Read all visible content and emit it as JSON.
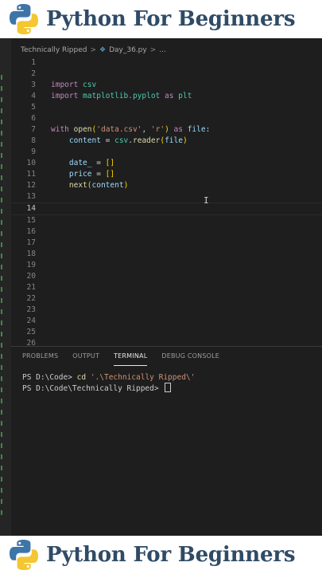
{
  "banner": {
    "title": "Python For Beginners"
  },
  "breadcrumb": {
    "folder": "Technically Ripped",
    "separator": ">",
    "file": "Day_36.py",
    "more": "..."
  },
  "editor": {
    "current_line": 14,
    "lines": [
      {
        "n": "1",
        "tokens": []
      },
      {
        "n": "2",
        "tokens": []
      },
      {
        "n": "3",
        "tokens": [
          {
            "t": "import",
            "c": "kw"
          },
          {
            "t": " csv",
            "c": "mod"
          }
        ]
      },
      {
        "n": "4",
        "tokens": [
          {
            "t": "import",
            "c": "kw"
          },
          {
            "t": " matplotlib.pyplot",
            "c": "mod"
          },
          {
            "t": " as",
            "c": "kw"
          },
          {
            "t": " plt",
            "c": "mod"
          }
        ]
      },
      {
        "n": "5",
        "tokens": []
      },
      {
        "n": "6",
        "tokens": []
      },
      {
        "n": "7",
        "tokens": [
          {
            "t": "with",
            "c": "kw"
          },
          {
            "t": " ",
            "c": "def"
          },
          {
            "t": "open",
            "c": "fn"
          },
          {
            "t": "(",
            "c": "brk"
          },
          {
            "t": "'data.csv'",
            "c": "str"
          },
          {
            "t": ", ",
            "c": "def"
          },
          {
            "t": "'r'",
            "c": "str"
          },
          {
            "t": ")",
            "c": "brk"
          },
          {
            "t": " as",
            "c": "kw"
          },
          {
            "t": " file",
            "c": "var"
          },
          {
            "t": ":",
            "c": "def"
          }
        ]
      },
      {
        "n": "8",
        "tokens": [
          {
            "t": "    content",
            "c": "var"
          },
          {
            "t": " = ",
            "c": "def"
          },
          {
            "t": "csv",
            "c": "mod"
          },
          {
            "t": ".",
            "c": "def"
          },
          {
            "t": "reader",
            "c": "fn"
          },
          {
            "t": "(",
            "c": "brk"
          },
          {
            "t": "file",
            "c": "var"
          },
          {
            "t": ")",
            "c": "brk"
          }
        ]
      },
      {
        "n": "9",
        "tokens": []
      },
      {
        "n": "10",
        "tokens": [
          {
            "t": "    date_",
            "c": "var"
          },
          {
            "t": " = ",
            "c": "def"
          },
          {
            "t": "[]",
            "c": "brk"
          }
        ]
      },
      {
        "n": "11",
        "tokens": [
          {
            "t": "    price",
            "c": "var"
          },
          {
            "t": " = ",
            "c": "def"
          },
          {
            "t": "[]",
            "c": "brk"
          }
        ]
      },
      {
        "n": "12",
        "tokens": [
          {
            "t": "    ",
            "c": "def"
          },
          {
            "t": "next",
            "c": "fn"
          },
          {
            "t": "(",
            "c": "brk"
          },
          {
            "t": "content",
            "c": "var"
          },
          {
            "t": ")",
            "c": "brk"
          }
        ]
      },
      {
        "n": "13",
        "tokens": []
      },
      {
        "n": "14",
        "tokens": []
      },
      {
        "n": "15",
        "tokens": []
      },
      {
        "n": "16",
        "tokens": []
      },
      {
        "n": "17",
        "tokens": []
      },
      {
        "n": "18",
        "tokens": []
      },
      {
        "n": "19",
        "tokens": []
      },
      {
        "n": "20",
        "tokens": []
      },
      {
        "n": "21",
        "tokens": []
      },
      {
        "n": "22",
        "tokens": []
      },
      {
        "n": "23",
        "tokens": []
      },
      {
        "n": "24",
        "tokens": []
      },
      {
        "n": "25",
        "tokens": []
      },
      {
        "n": "26",
        "tokens": []
      }
    ]
  },
  "panel": {
    "tabs": [
      {
        "label": "PROBLEMS",
        "active": false
      },
      {
        "label": "OUTPUT",
        "active": false
      },
      {
        "label": "TERMINAL",
        "active": true
      },
      {
        "label": "DEBUG CONSOLE",
        "active": false
      }
    ],
    "terminal": {
      "line1_prompt": "PS D:\\Code> ",
      "line1_cmd": "cd",
      "line1_arg": " '.\\Technically Ripped\\'",
      "line2_prompt": "PS D:\\Code\\Technically Ripped> "
    }
  },
  "colors": {
    "banner_text": "#2f4b66",
    "editor_bg": "#1e1e1e",
    "keyword": "#c586c0",
    "string": "#ce9178"
  }
}
